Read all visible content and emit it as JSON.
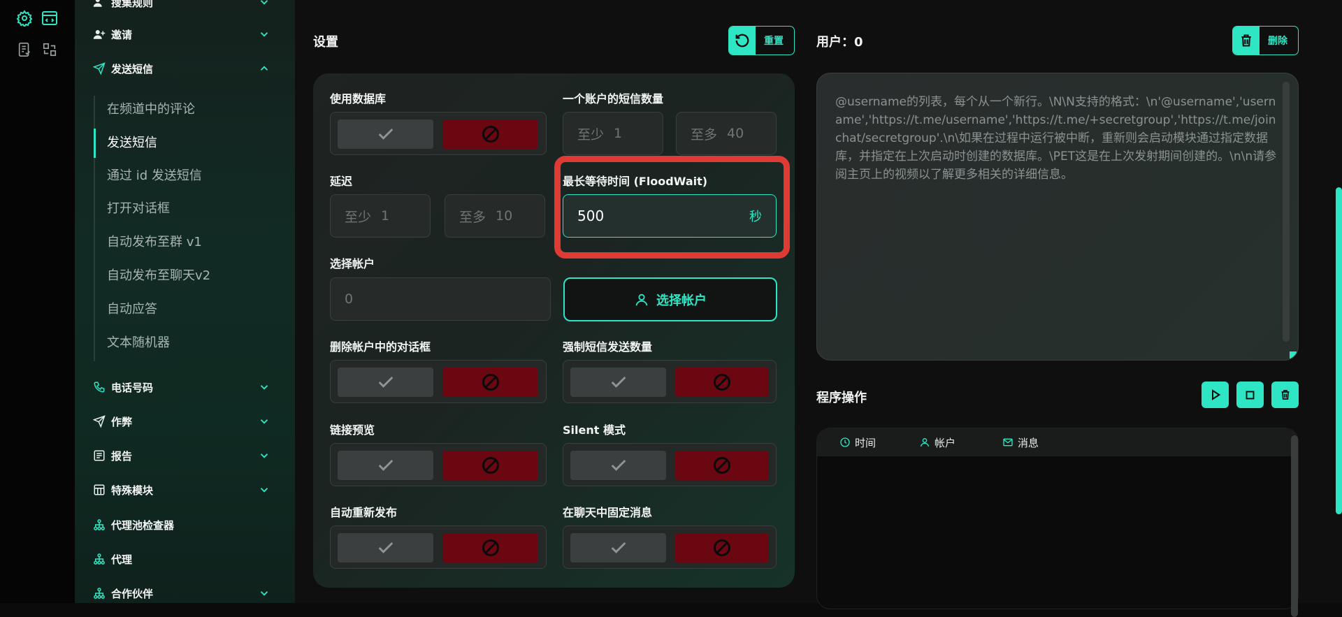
{
  "colors": {
    "accent": "#2ee6c4",
    "danger": "#6a0711",
    "highlight": "#e03a34"
  },
  "sidebar": {
    "items": [
      {
        "label": "搜集规则",
        "icon": "users-icon"
      },
      {
        "label": "邀请",
        "icon": "user-plus-icon"
      },
      {
        "label": "发送短信",
        "icon": "send-icon"
      },
      {
        "label": "电话号码",
        "icon": "phone-icon"
      },
      {
        "label": "作弊",
        "icon": "send-icon"
      },
      {
        "label": "报告",
        "icon": "report-icon"
      },
      {
        "label": "特殊模块",
        "icon": "table-icon"
      },
      {
        "label": "代理池检查器",
        "icon": "network-icon"
      },
      {
        "label": "代理",
        "icon": "network-icon"
      },
      {
        "label": "合作伙伴",
        "icon": "network-icon"
      }
    ],
    "subitems": [
      "在频道中的评论",
      "发送短信",
      "通过 id 发送短信",
      "打开对话框",
      "自动发布至群 v1",
      "自动发布至聊天v2",
      "自动应答",
      "文本随机器"
    ],
    "active_sub": "发送短信"
  },
  "settings": {
    "title": "设置",
    "reset_label": "重置",
    "use_db_label": "使用数据库",
    "msg_count_label": "一个账户的短信数量",
    "msg_min_ph": "至少",
    "msg_min_val": "1",
    "msg_max_ph": "至多",
    "msg_max_val": "40",
    "delay_label": "延迟",
    "delay_min_ph": "至少",
    "delay_min_val": "1",
    "delay_max_ph": "至多",
    "delay_max_val": "10",
    "floodwait_label": "最长等待时间 (FloodWait)",
    "floodwait_value": "500",
    "floodwait_unit": "秒",
    "select_account_label": "选择帐户",
    "account_count": "0",
    "select_account_button": "选择帐户",
    "delete_dialogs_label": "删除帐户中的对话框",
    "force_count_label": "强制短信发送数量",
    "link_preview_label": "链接预览",
    "silent_label": "Silent 模式",
    "auto_republish_label": "自动重新发布",
    "pin_message_label": "在聊天中固定消息"
  },
  "users": {
    "title": "用户：0",
    "delete_label": "删除",
    "placeholder": "@username的列表，每个从一个新行。\\N\\N支持的格式：\\n'@username','username','https://t.me/username','https://t.me/+secretgroup','https://t.me/joinchat/secretgroup'.\\n\\如果在过程中运行被中断，重新则会启动模块通过指定数据库，并指定在上次启动时创建的数据库。\\PET这是在上次发射期间创建的。\\n\\n请参阅主页上的视频以了解更多相关的详细信息。"
  },
  "operations": {
    "title": "程序操作",
    "columns": [
      "时间",
      "帐户",
      "消息"
    ]
  }
}
